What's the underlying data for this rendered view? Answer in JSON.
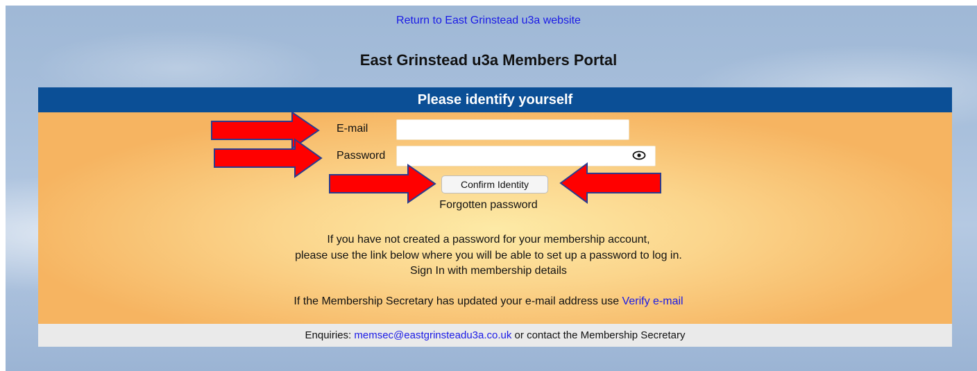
{
  "top_link": "Return to East Grinstead u3a website",
  "page_title": "East Grinstead u3a Members Portal",
  "panel": {
    "header": "Please identify yourself",
    "email_label": "E-mail",
    "email_value": "",
    "password_label": "Password",
    "password_value": "",
    "confirm_button": "Confirm Identity",
    "forgot_link": "Forgotten password",
    "info_line1": "If you have not created a password for your membership account,",
    "info_line2": "please use the link below where you will be able to set up a password to log in.",
    "signin_link": "Sign In with membership details",
    "verify_text": "If the Membership Secretary has updated your e-mail address use ",
    "verify_link": "Verify e-mail"
  },
  "footer": {
    "prefix": "Enquiries: ",
    "email_link": "memsec@eastgrinsteadu3a.co.uk",
    "suffix": " or contact the Membership Secretary"
  },
  "icons": {
    "show_password": "eye-icon",
    "annotation": "red-arrow-icon"
  },
  "colors": {
    "header_bg": "#0b4f96",
    "panel_bg": "#f6b461",
    "link": "#1a1ae6",
    "arrow": "#ff0000"
  }
}
